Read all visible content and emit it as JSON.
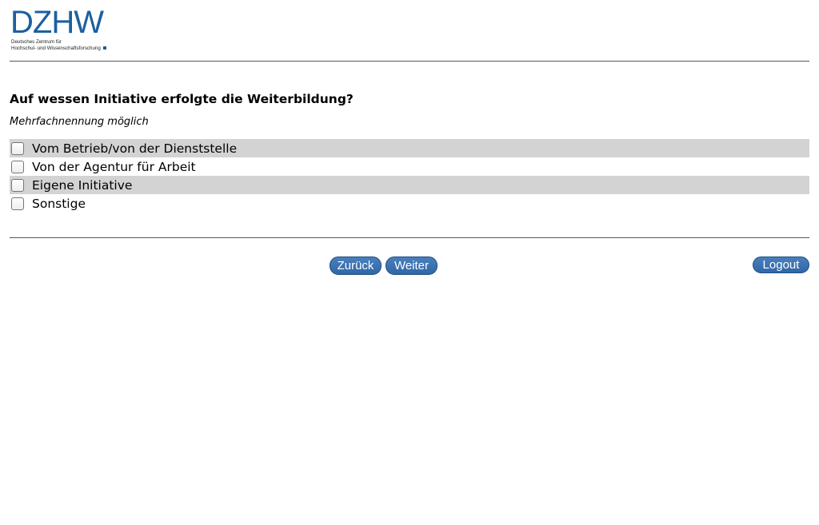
{
  "logo": {
    "letters": "DZHW",
    "line1": "Deutsches Zentrum für",
    "line2": "Hochschul- und Wissenschaftsforschung",
    "brand_color": "#1d5fa0"
  },
  "question": {
    "title": "Auf wessen Initiative erfolgte die Weiterbildung?",
    "hint": "Mehrfachnennung möglich"
  },
  "options": [
    {
      "label": "Vom Betrieb/von der Dienststelle",
      "checked": false
    },
    {
      "label": "Von der Agentur für Arbeit",
      "checked": false
    },
    {
      "label": "Eigene Initiative",
      "checked": false
    },
    {
      "label": "Sonstige",
      "checked": false
    }
  ],
  "nav": {
    "back_label": "Zurück",
    "next_label": "Weiter",
    "logout_label": "Logout"
  },
  "colors": {
    "row_shade": "#d3d3d3",
    "button": "#2f67a8"
  }
}
